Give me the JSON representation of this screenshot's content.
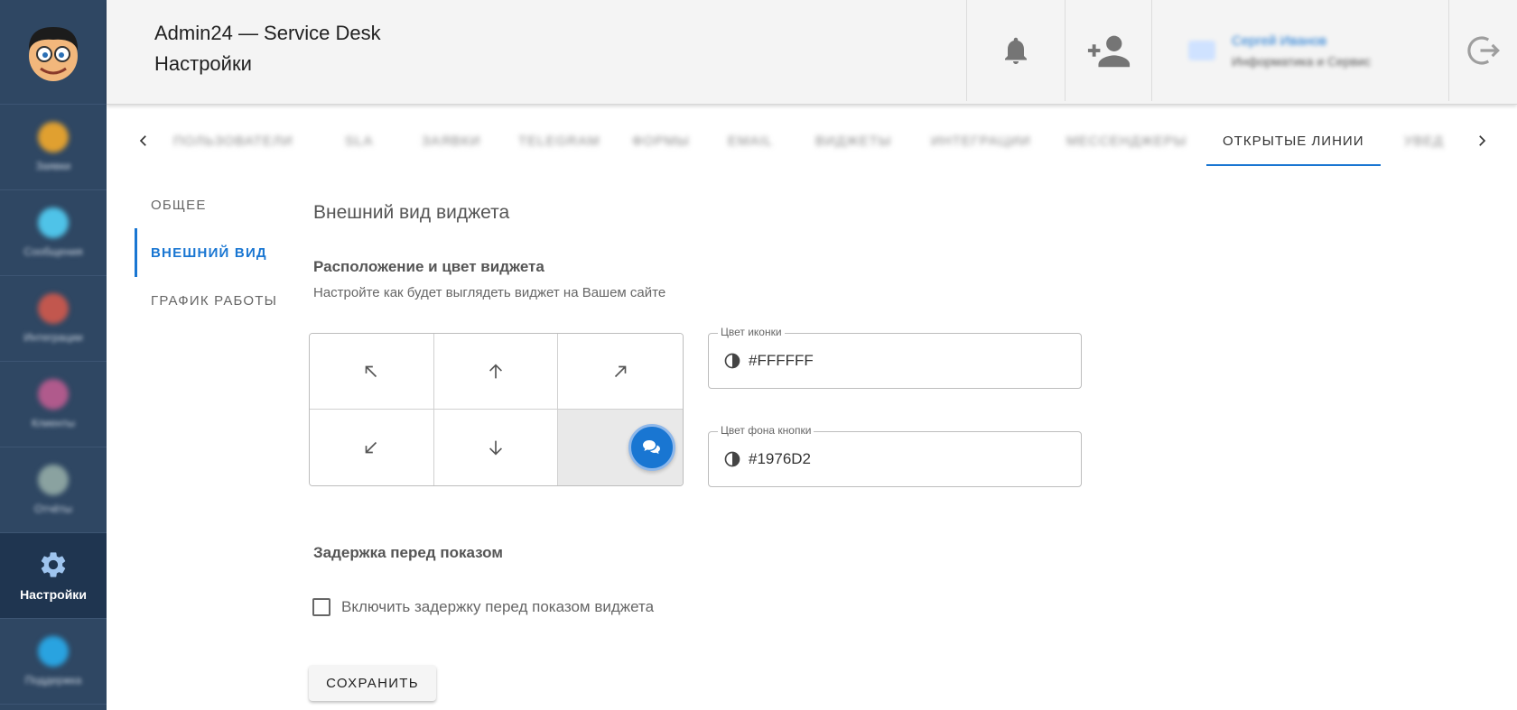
{
  "header": {
    "app_title": "Admin24 — Service Desk",
    "page_title": "Настройки",
    "notifications_icon": "bell-icon",
    "add_user_icon": "person-add-icon",
    "logout_icon": "logout-icon"
  },
  "rail": {
    "active_label": "Настройки"
  },
  "tabs": {
    "active": "ОТКРЫТЫЕ ЛИНИИ"
  },
  "side_menu": [
    {
      "label": "ОБЩЕЕ"
    },
    {
      "label": "ВНЕШНИЙ ВИД"
    },
    {
      "label": "ГРАФИК РАБОТЫ"
    }
  ],
  "main": {
    "section_title": "Внешний вид виджета",
    "position_title": "Расположение и цвет виджета",
    "position_desc": "Настройте как будет выглядеть виджет на Вашем сайте",
    "selected_position": "bottom-right",
    "icon_color_label": "Цвет иконки",
    "icon_color_value": "#FFFFFF",
    "bg_color_label": "Цвет фона кнопки",
    "bg_color_value": "#1976D2",
    "delay_title": "Задержка перед показом",
    "delay_checkbox_label": "Включить задержку перед показом виджета",
    "delay_enabled": false,
    "save_label": "СОХРАНИТЬ"
  },
  "colors": {
    "accent": "#1976d2",
    "rail_bg": "#2f4763"
  }
}
